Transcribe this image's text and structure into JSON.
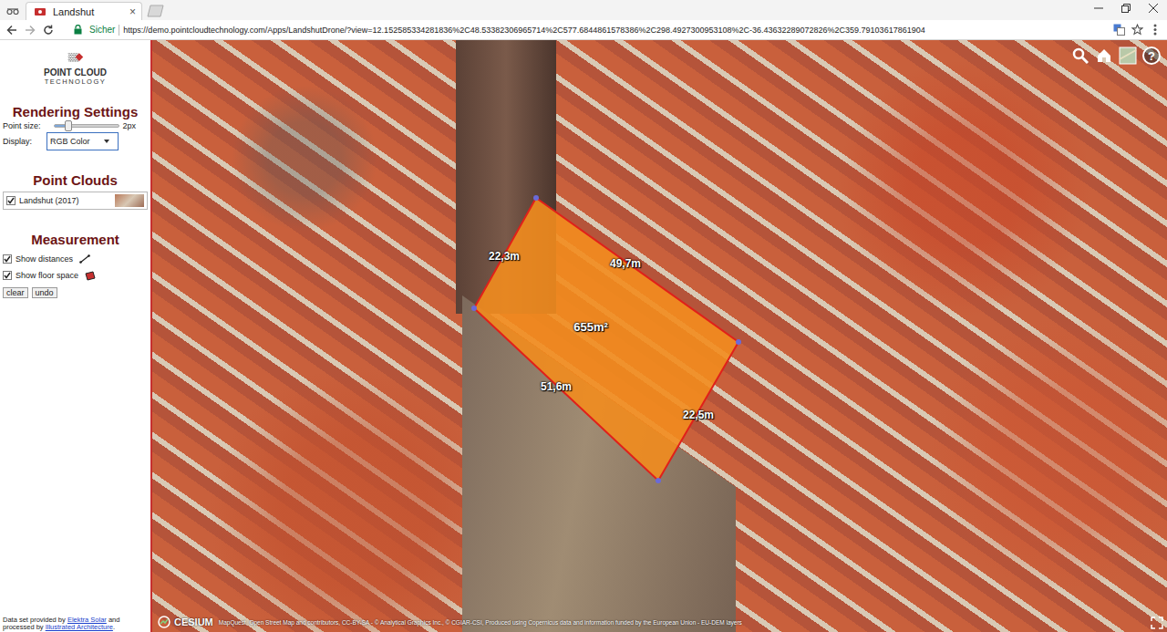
{
  "window": {
    "title": "Landshut"
  },
  "tabs": [
    {
      "label": "Landshut",
      "selected": true,
      "close": "×"
    }
  ],
  "address_bar": {
    "security": "Sicher",
    "url": "https://demo.pointcloudtechnology.com/Apps/LandshutDrone/?view=12.152585334281836%2C48.53382306965714%2C577.6844861578386%2C298.4927300953108%2C-36.43632289072826%2C359.79103617861904"
  },
  "sidebar": {
    "logo": {
      "line1": "POINT CLOUD",
      "line2": "TECHNOLOGY"
    },
    "rendering": {
      "title": "Rendering Settings",
      "point_size": {
        "label": "Point size:",
        "level": 0.22,
        "reading": "2px"
      },
      "display": {
        "label": "Display:",
        "value": "RGB Color"
      }
    },
    "point_clouds": {
      "title": "Point Clouds",
      "items": [
        {
          "label": "Landshut (2017)",
          "checked": true
        }
      ]
    },
    "measurement": {
      "title": "Measurement",
      "options": [
        {
          "label": "Show distances",
          "checked": true
        },
        {
          "label": "Show floor space",
          "checked": true
        }
      ],
      "buttons": [
        "clear",
        "undo"
      ]
    },
    "credits": {
      "line1_before": "Data set provided by ",
      "line1_link": "Elektra Solar",
      "line1_after": " and",
      "line2_before": "processed by ",
      "line2_link": "Illustrated Architecture",
      "line2_after": "."
    }
  },
  "viewer": {
    "measurements": [
      {
        "text": "22,3m",
        "kind": "distance"
      },
      {
        "text": "49,7m",
        "kind": "distance"
      },
      {
        "text": "655m²",
        "kind": "area"
      },
      {
        "text": "51,6m",
        "kind": "distance"
      },
      {
        "text": "22,5m",
        "kind": "distance"
      }
    ],
    "help": "?",
    "logo": "CESIUM",
    "attribution": "MapQuest, Open Street Map and contributors, CC-BY-SA - © Analytical Graphics Inc., © CGIAR-CSI, Produced using Copernicus data and information funded by the European Union - EU-DEM layers"
  }
}
